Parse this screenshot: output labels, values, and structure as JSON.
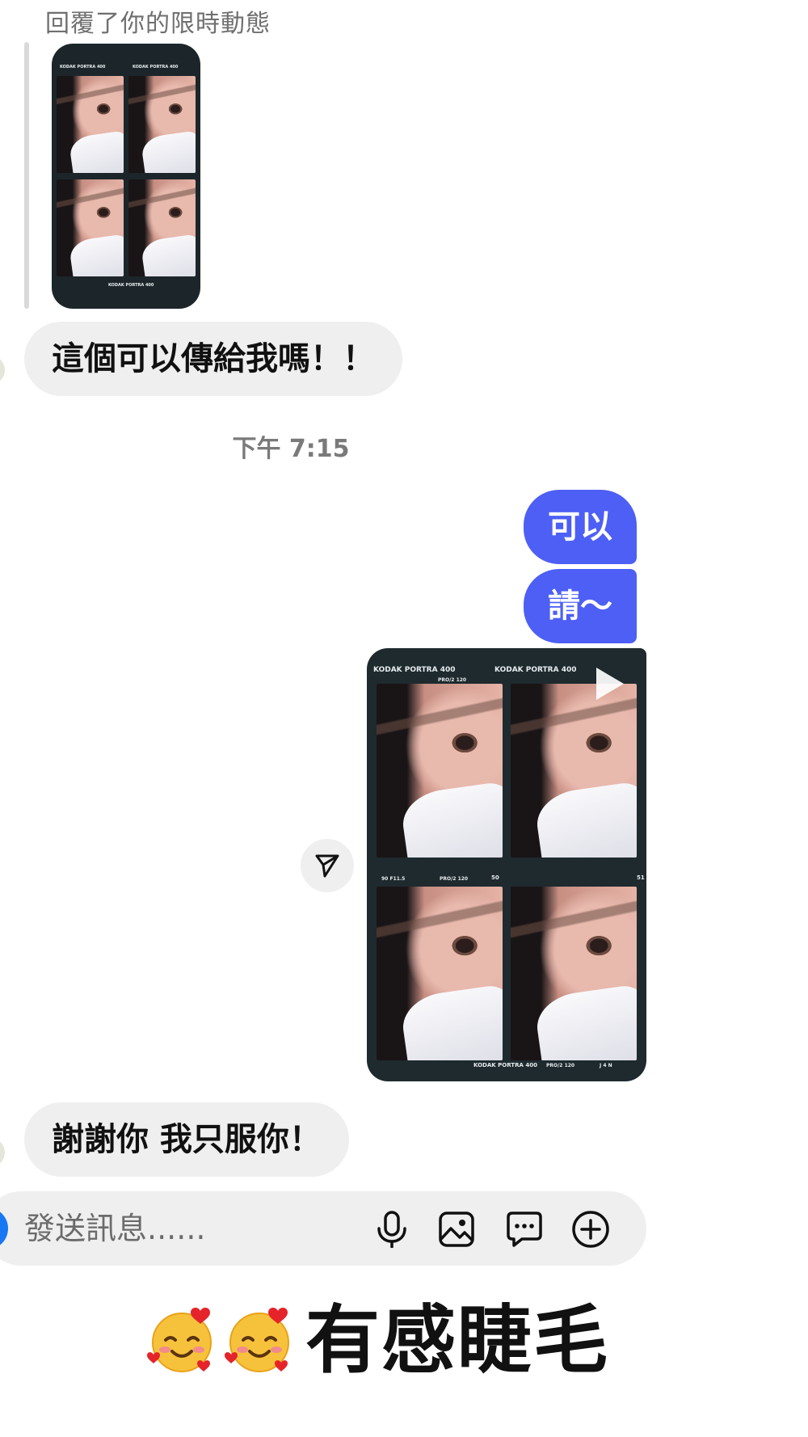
{
  "reply_header": {
    "label": "回覆了你的限時動態"
  },
  "story_thumb": {
    "film_brand": "KODAK PORTRA 400",
    "film_code": "KODAK PORTRA 400"
  },
  "messages": {
    "received_1": "這個可以傳給我嗎！！",
    "timestamp": "下午 7:15",
    "sent_1": "可以",
    "sent_2": "請～",
    "received_2": "謝謝你 我只服你！"
  },
  "video": {
    "film_brand_left": "KODAK PORTRA 400",
    "film_brand_right": "KODAK PORTRA 400",
    "frame_tag": "90 F11.5",
    "frame_code": "PRO/2 120",
    "frame_num_top": "50",
    "frame_num_right": "51",
    "bottom_brand": "KODAK PORTRA 400",
    "bottom_code": "PRO/2 120",
    "bottom_marks": "J 4 N"
  },
  "composer": {
    "placeholder": "發送訊息......",
    "icons": [
      "microphone-icon",
      "image-icon",
      "sticker-icon",
      "plus-circle-icon"
    ]
  },
  "caption": {
    "text": "有感睫毛"
  },
  "colors": {
    "sent_bubble": "#4d5ff5",
    "received_bubble": "#efefef",
    "composer_bg": "#efefef",
    "film_bg": "#1e2a2e"
  }
}
